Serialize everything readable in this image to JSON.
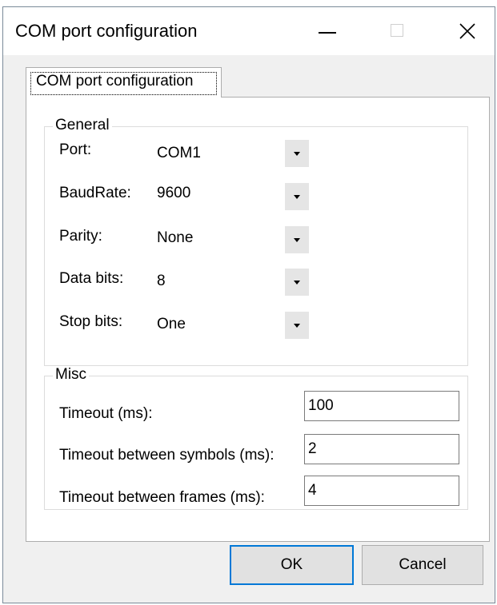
{
  "window": {
    "title": "COM port configuration",
    "controls": [
      "minimize-icon",
      "maximize-icon",
      "close-icon"
    ]
  },
  "tab": {
    "label": "COM port configuration"
  },
  "general": {
    "legend": "General",
    "rows": [
      {
        "label": "Port:",
        "value": "COM1"
      },
      {
        "label": "BaudRate:",
        "value": "9600"
      },
      {
        "label": "Parity:",
        "value": "None"
      },
      {
        "label": "Data bits:",
        "value": "8"
      },
      {
        "label": "Stop bits:",
        "value": "One"
      }
    ]
  },
  "misc": {
    "legend": "Misc",
    "rows": [
      {
        "label": "Timeout (ms):",
        "value": "100"
      },
      {
        "label": "Timeout between symbols (ms):",
        "value": "2"
      },
      {
        "label": "Timeout between frames (ms):",
        "value": "4"
      }
    ]
  },
  "buttons": {
    "ok": "OK",
    "cancel": "Cancel"
  },
  "colors": {
    "focus_border": "#0078d7",
    "window_bg": "#f0f0f0"
  }
}
